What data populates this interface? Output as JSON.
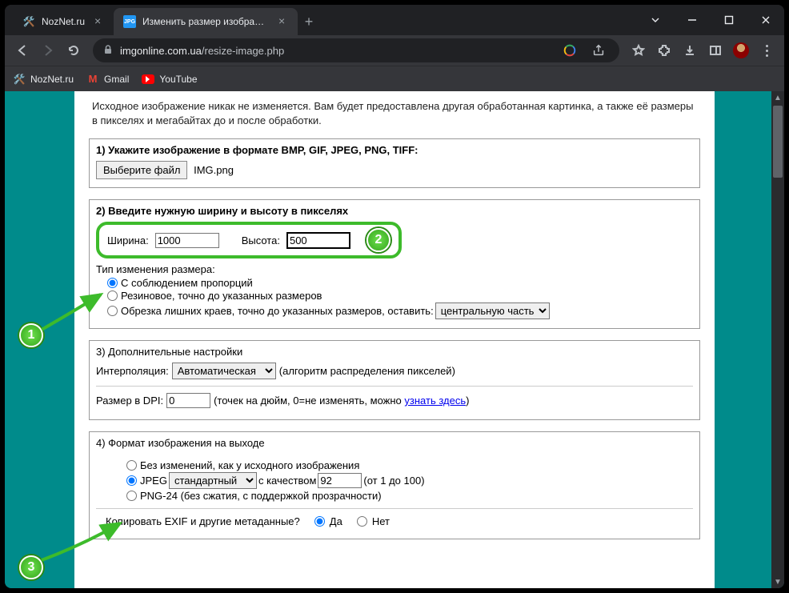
{
  "window": {
    "tabs": [
      {
        "title": "NozNet.ru",
        "active": false
      },
      {
        "title": "Изменить размер изображения",
        "active": true
      }
    ],
    "newtab": "+"
  },
  "toolbar": {
    "url_domain": "imgonline.com.ua",
    "url_path": "/resize-image.php"
  },
  "bookmarks": [
    {
      "label": "NozNet.ru",
      "icon": "tools"
    },
    {
      "label": "Gmail",
      "icon": "gmail"
    },
    {
      "label": "YouTube",
      "icon": "youtube"
    }
  ],
  "page": {
    "intro": "Исходное изображение никак не изменяется. Вам будет предоставлена другая обработанная картинка, а также её размеры в пикселях и мегабайтах до и после обработки.",
    "step1": {
      "title": "1) Укажите изображение в формате BMP, GIF, JPEG, PNG, TIFF:",
      "button": "Выберите файл",
      "filename": "IMG.png"
    },
    "step2": {
      "title": "2) Введите нужную ширину и высоту в пикселях",
      "width_label": "Ширина:",
      "width_value": "1000",
      "height_label": "Высота:",
      "height_value": "500",
      "resize_type_label": "Тип изменения размера:",
      "opt_prop": "С соблюдением пропорций",
      "opt_stretch": "Резиновое, точно до указанных размеров",
      "opt_crop": "Обрезка лишних краев, точно до указанных размеров, оставить:",
      "crop_select": "центральную часть"
    },
    "step3": {
      "title": "3) Дополнительные настройки",
      "interp_label": "Интерполяция:",
      "interp_value": "Автоматическая",
      "interp_note": "(алгоритм распределения пикселей)",
      "dpi_label": "Размер в DPI:",
      "dpi_value": "0",
      "dpi_note_pre": "(точек на дюйм, 0=не изменять, можно ",
      "dpi_link": "узнать здесь",
      "dpi_note_post": ")"
    },
    "step4": {
      "title": "4) Формат изображения на выходе",
      "opt_same": "Без изменений, как у исходного изображения",
      "opt_jpeg": "JPEG",
      "jpeg_preset": "стандартный",
      "jpeg_q_label": "с качеством",
      "jpeg_q_value": "92",
      "jpeg_q_note": "(от 1 до 100)",
      "opt_png": "PNG-24 (без сжатия, с поддержкой прозрачности)",
      "exif_label": "Копировать EXIF и другие метаданные?",
      "exif_yes": "Да",
      "exif_no": "Нет"
    }
  },
  "badges": {
    "b1": "1",
    "b2": "2",
    "b3": "3"
  }
}
